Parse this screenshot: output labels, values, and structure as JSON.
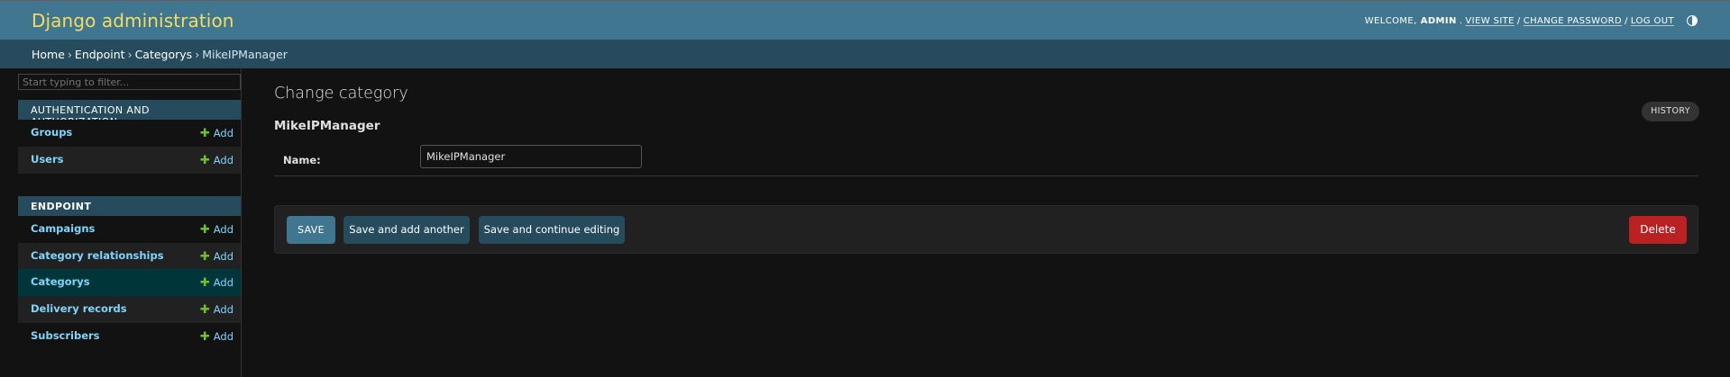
{
  "header": {
    "brand": "Django administration",
    "welcome_label": "WELCOME,",
    "username": "ADMIN",
    "view_site": "VIEW SITE",
    "change_password": "CHANGE PASSWORD",
    "log_out": "LOG OUT",
    "separator": "/",
    "theme_toggle_icon": "contrast-icon"
  },
  "breadcrumbs": {
    "items": [
      "Home",
      "Endpoint",
      "Categorys",
      "MikeIPManager"
    ],
    "separator": "›"
  },
  "sidebar": {
    "filter_placeholder": "Start typing to filter...",
    "modules": [
      {
        "caption": "AUTHENTICATION AND AUTHORIZATION",
        "models": [
          {
            "name": "Groups",
            "add": "Add"
          },
          {
            "name": "Users",
            "add": "Add"
          }
        ]
      },
      {
        "caption": "ENDPOINT",
        "models": [
          {
            "name": "Campaigns",
            "add": "Add"
          },
          {
            "name": "Category relationships",
            "add": "Add"
          },
          {
            "name": "Categorys",
            "add": "Add",
            "selected": true
          },
          {
            "name": "Delivery records",
            "add": "Add"
          },
          {
            "name": "Subscribers",
            "add": "Add"
          }
        ]
      }
    ]
  },
  "main": {
    "title": "Change category",
    "history_button": "HISTORY",
    "object_title": "MikeIPManager",
    "fields": {
      "name_label": "Name:",
      "name_value": "MikeIPManager"
    },
    "buttons": {
      "save": "SAVE",
      "save_add_another": "Save and add another",
      "save_continue": "Save and continue editing",
      "delete": "Delete"
    }
  },
  "colors": {
    "header_bg": "#417690",
    "brand": "#f5dd5d",
    "breadcrumb_bg": "#264b5d",
    "link": "#81d4fa",
    "add_icon": "#70bf2b",
    "selected_row": "#00363a",
    "delete": "#ba2121"
  }
}
